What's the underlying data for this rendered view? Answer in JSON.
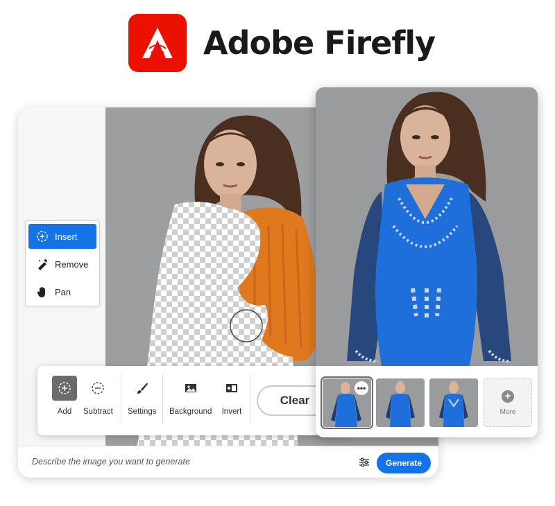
{
  "brand": {
    "name": "Adobe Firefly",
    "logo_icon": "adobe-firefly-logo-icon",
    "color": "#eb1000"
  },
  "tools": {
    "items": [
      {
        "label": "Insert",
        "icon": "insert-icon",
        "active": true
      },
      {
        "label": "Remove",
        "icon": "remove-icon",
        "active": false
      },
      {
        "label": "Pan",
        "icon": "hand-icon",
        "active": false
      }
    ]
  },
  "toolbar": {
    "add_label": "Add",
    "subtract_label": "Subtract",
    "settings_label": "Settings",
    "background_label": "Background",
    "invert_label": "Invert",
    "clear_label": "Clear"
  },
  "prompt": {
    "placeholder": "Describe the image you want to generate",
    "generate_label": "Generate"
  },
  "results": {
    "more_label": "More",
    "thumb_menu": "•••"
  },
  "colors": {
    "accent": "#1473e6",
    "brand_red": "#eb1000",
    "dress_blue": "#1e6fd9",
    "sweater_orange": "#e0791e"
  }
}
